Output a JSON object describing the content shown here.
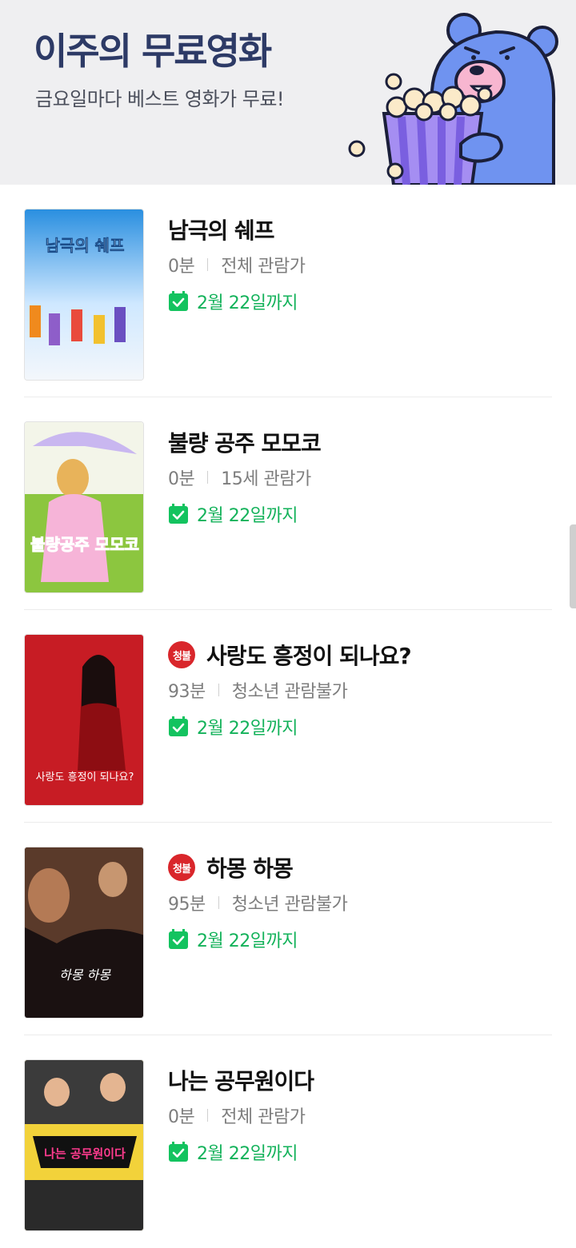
{
  "header": {
    "title": "이주의 무료영화",
    "subtitle": "금요일마다 베스트 영화가 무료!"
  },
  "colors": {
    "header_bg": "#efeff1",
    "title_color": "#2d3a66",
    "deadline_green": "#13b25a",
    "badge_red": "#d9262b"
  },
  "movies": [
    {
      "title": "남극의 쉐프",
      "duration": "0분",
      "rating": "전체 관람가",
      "badge": "",
      "deadline": "2월 22일까지",
      "poster_text": "남극의 쉐프"
    },
    {
      "title": "불량 공주 모모코",
      "duration": "0분",
      "rating": "15세 관람가",
      "badge": "",
      "deadline": "2월 22일까지",
      "poster_text": "불량공주 모모코"
    },
    {
      "title": "사랑도 흥정이 되나요?",
      "duration": "93분",
      "rating": "청소년 관람불가",
      "badge": "청불",
      "deadline": "2월 22일까지",
      "poster_text": "사랑도 흥정이 되나요?"
    },
    {
      "title": "하몽 하몽",
      "duration": "95분",
      "rating": "청소년 관람불가",
      "badge": "청불",
      "deadline": "2월 22일까지",
      "poster_text": "하몽 하몽"
    },
    {
      "title": "나는 공무원이다",
      "duration": "0분",
      "rating": "전체 관람가",
      "badge": "",
      "deadline": "2월 22일까지",
      "poster_text": "나는 공무원이다"
    }
  ]
}
